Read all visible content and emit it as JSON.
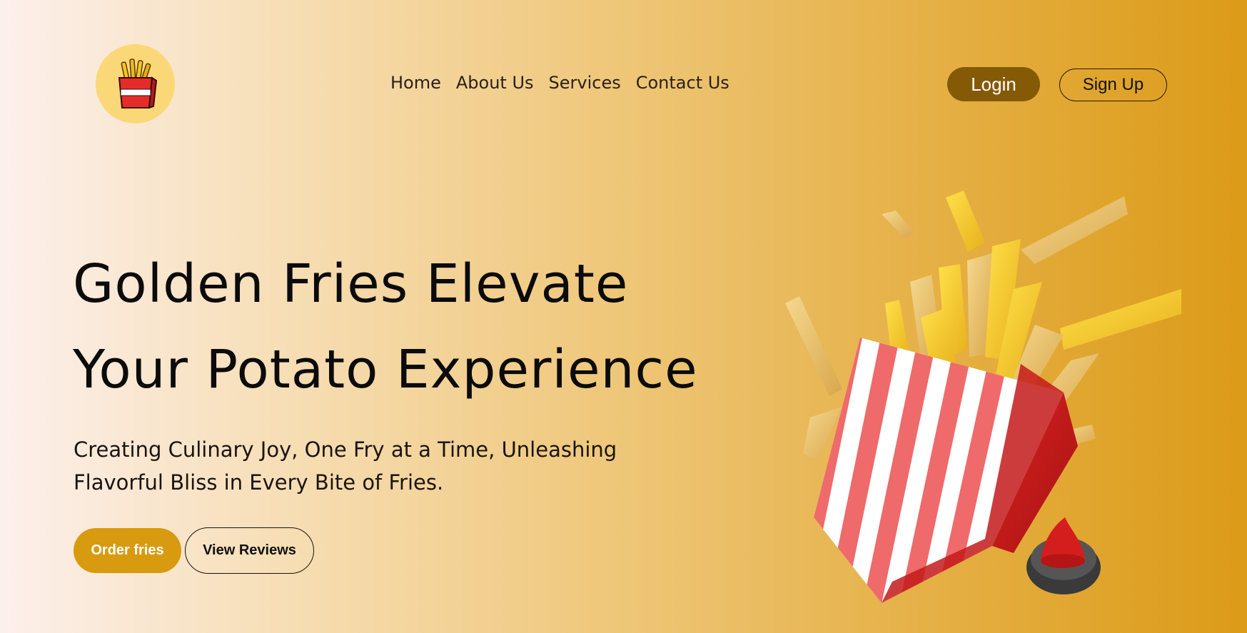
{
  "header": {
    "logo_icon": "fries-box-icon",
    "nav": [
      {
        "label": "Home"
      },
      {
        "label": "About Us"
      },
      {
        "label": "Services"
      },
      {
        "label": "Contact Us"
      }
    ],
    "login_label": "Login",
    "signup_label": "Sign Up"
  },
  "hero": {
    "title_line1": "Golden Fries Elevate",
    "title_line2": "Your Potato Experience",
    "subtitle_line1": "Creating Culinary Joy, One Fry at a Time, Unleashing",
    "subtitle_line2": "Flavorful Bliss in Every Bite of Fries.",
    "order_label": "Order fries",
    "reviews_label": "View Reviews",
    "image_icon": "fries-cone-illustration"
  },
  "colors": {
    "accent": "#d89a0e",
    "login_bg": "#855a06",
    "logo_bg": "#fbd877"
  }
}
